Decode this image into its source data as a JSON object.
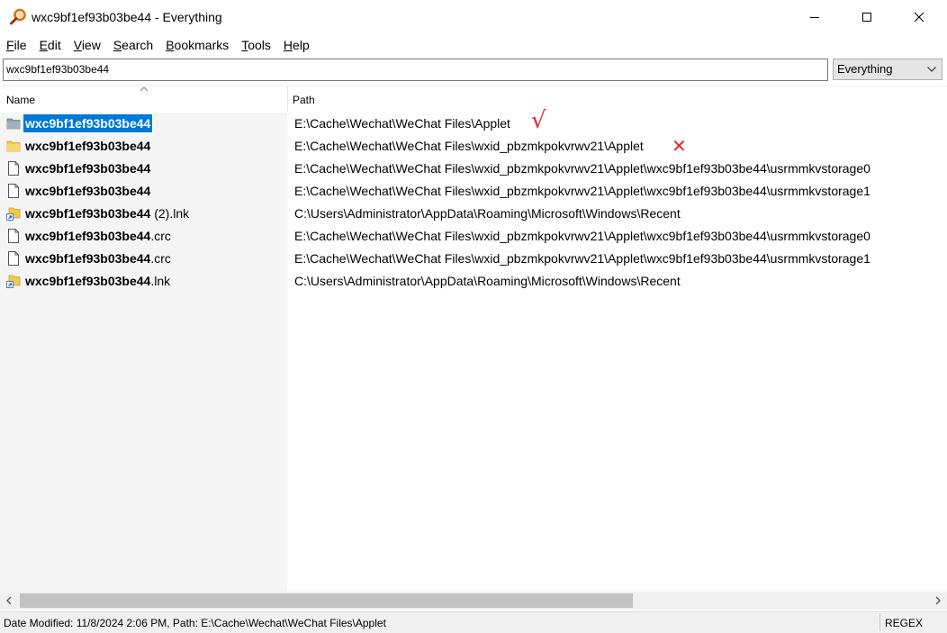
{
  "window": {
    "title": "wxc9bf1ef93b03be44 - Everything"
  },
  "menu": [
    {
      "label": "File",
      "accel": "F",
      "rest": "ile"
    },
    {
      "label": "Edit",
      "accel": "E",
      "rest": "dit"
    },
    {
      "label": "View",
      "accel": "V",
      "rest": "iew"
    },
    {
      "label": "Search",
      "accel": "S",
      "rest": "earch"
    },
    {
      "label": "Bookmarks",
      "accel": "B",
      "rest": "ookmarks"
    },
    {
      "label": "Tools",
      "accel": "T",
      "rest": "ools"
    },
    {
      "label": "Help",
      "accel": "H",
      "rest": "elp"
    }
  ],
  "search": {
    "value": "wxc9bf1ef93b03be44",
    "filter": "Everything"
  },
  "columns": {
    "name": "Name",
    "path": "Path"
  },
  "rows": [
    {
      "icon": "folder-icon",
      "name_bold": "wxc9bf1ef93b03be44",
      "name_rest": "",
      "path": "E:\\Cache\\Wechat\\WeChat Files\\Applet",
      "selected": true,
      "mark": "√"
    },
    {
      "icon": "folder-icon",
      "name_bold": "wxc9bf1ef93b03be44",
      "name_rest": "",
      "path": "E:\\Cache\\Wechat\\WeChat Files\\wxid_pbzmkpokvrwv21\\Applet",
      "mark": "✕"
    },
    {
      "icon": "file-icon",
      "name_bold": "wxc9bf1ef93b03be44",
      "name_rest": "",
      "path": "E:\\Cache\\Wechat\\WeChat Files\\wxid_pbzmkpokvrwv21\\Applet\\wxc9bf1ef93b03be44\\usrmmkvstorage0"
    },
    {
      "icon": "file-icon",
      "name_bold": "wxc9bf1ef93b03be44",
      "name_rest": "",
      "path": "E:\\Cache\\Wechat\\WeChat Files\\wxid_pbzmkpokvrwv21\\Applet\\wxc9bf1ef93b03be44\\usrmmkvstorage1"
    },
    {
      "icon": "shortcut-icon",
      "name_bold": "wxc9bf1ef93b03be44",
      "name_rest": " (2).lnk",
      "path": "C:\\Users\\Administrator\\AppData\\Roaming\\Microsoft\\Windows\\Recent"
    },
    {
      "icon": "file-icon",
      "name_bold": "wxc9bf1ef93b03be44",
      "name_rest": ".crc",
      "path": "E:\\Cache\\Wechat\\WeChat Files\\wxid_pbzmkpokvrwv21\\Applet\\wxc9bf1ef93b03be44\\usrmmkvstorage0"
    },
    {
      "icon": "file-icon",
      "name_bold": "wxc9bf1ef93b03be44",
      "name_rest": ".crc",
      "path": "E:\\Cache\\Wechat\\WeChat Files\\wxid_pbzmkpokvrwv21\\Applet\\wxc9bf1ef93b03be44\\usrmmkvstorage1"
    },
    {
      "icon": "shortcut-icon",
      "name_bold": "wxc9bf1ef93b03be44",
      "name_rest": ".lnk",
      "path": "C:\\Users\\Administrator\\AppData\\Roaming\\Microsoft\\Windows\\Recent"
    }
  ],
  "status": {
    "text": "Date Modified: 11/8/2024 2:06 PM, Path: E:\\Cache\\Wechat\\WeChat Files\\Applet",
    "mode": "REGEX"
  },
  "colors": {
    "selection": "#0078d7",
    "annotation": "#e8262a",
    "folder": "#f2c94c"
  }
}
